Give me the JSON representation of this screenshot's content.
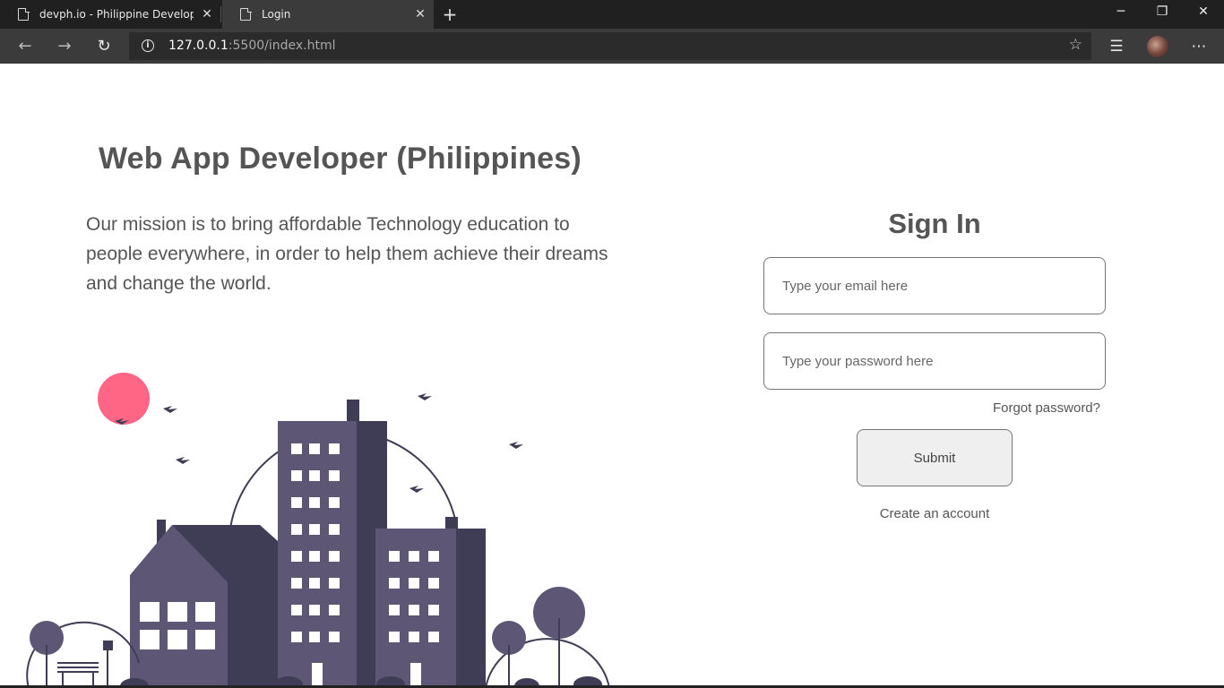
{
  "browser": {
    "tabs": [
      {
        "title": "devph.io - Philippine Developers"
      },
      {
        "title": "Login"
      }
    ],
    "url_host": "127.0.0.1",
    "url_rest": ":5500/index.html"
  },
  "page": {
    "title": "Web App Developer (Philippines)",
    "mission": "Our mission is to bring affordable Technology education to people everywhere, in order to help them achieve their dreams and change the world."
  },
  "signin": {
    "title": "Sign In",
    "email_placeholder": "Type your email here",
    "password_placeholder": "Type your password here",
    "forgot": "Forgot password?",
    "submit": "Submit",
    "create": "Create an account"
  },
  "colors": {
    "building": "#5d5775",
    "building_dark": "#3f3d56",
    "sun": "#ff6584",
    "text": "#555555"
  }
}
